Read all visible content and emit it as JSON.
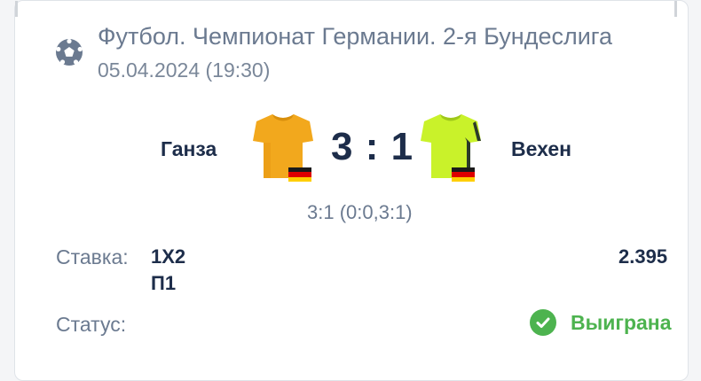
{
  "event": {
    "league": "Футбол. Чемпионат Германии. 2-я Бундеслига",
    "datetime": "05.04.2024 (19:30)"
  },
  "match": {
    "home_team": "Ганза",
    "away_team": "Вехен",
    "score": "3 : 1",
    "score_detail": "3:1 (0:0,3:1)",
    "home_shirt_color": "#f2a81d",
    "away_shirt_color": "#c9f22a",
    "flag_colors": [
      "#1a1a1a",
      "#dd0000",
      "#ffce00"
    ]
  },
  "bet": {
    "label": "Ставка:",
    "type": "1X2",
    "outcome": "П1",
    "odds": "2.395"
  },
  "status": {
    "label": "Статус:",
    "value": "Выиграна",
    "color": "#4db34f"
  },
  "icons": {
    "sport": "soccer-ball-icon",
    "status": "check-circle-icon"
  }
}
